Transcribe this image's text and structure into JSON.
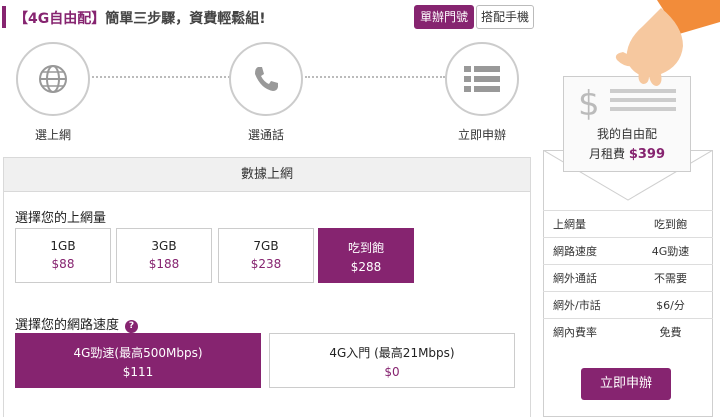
{
  "header": {
    "title_bracket": "【4G自由配】",
    "title_rest": "簡單三步驟，資費輕鬆組!",
    "tabs": [
      {
        "label": "單辦門號",
        "active": true
      },
      {
        "label": "搭配手機",
        "active": false
      }
    ]
  },
  "steps": [
    {
      "label": "選上網",
      "icon": "globe-icon"
    },
    {
      "label": "選通話",
      "icon": "phone-icon"
    },
    {
      "label": "立即申辦",
      "icon": "list-icon"
    }
  ],
  "data_panel": {
    "heading": "數據上網",
    "volume_title": "選擇您的上網量",
    "volume_options": [
      {
        "name": "1GB",
        "price": "$88",
        "selected": false
      },
      {
        "name": "3GB",
        "price": "$188",
        "selected": false
      },
      {
        "name": "7GB",
        "price": "$238",
        "selected": false
      },
      {
        "name": "吃到飽",
        "price": "$288",
        "selected": true
      }
    ],
    "speed_title": "選擇您的網路速度",
    "help_icon": "?",
    "speed_options": [
      {
        "name": "4G勁速(最高500Mbps)",
        "price": "$111",
        "selected": true
      },
      {
        "name": "4G入門 (最高21Mbps)",
        "price": "$0",
        "selected": false
      }
    ]
  },
  "summary": {
    "card_title": "我的自由配",
    "fee_label": "月租費",
    "fee_amount": "$399",
    "rows": [
      {
        "key": "上網量",
        "value": "吃到飽"
      },
      {
        "key": "網路速度",
        "value": "4G勁速"
      },
      {
        "key": "網外通話",
        "value": "不需要"
      },
      {
        "key": "網外/市話",
        "value": "$6/分"
      },
      {
        "key": "網內費率",
        "value": "免費"
      }
    ],
    "apply_label": "立即申辦"
  },
  "colors": {
    "accent": "#862470",
    "skin": "#f6c89f",
    "sleeve": "#f28c3a"
  }
}
